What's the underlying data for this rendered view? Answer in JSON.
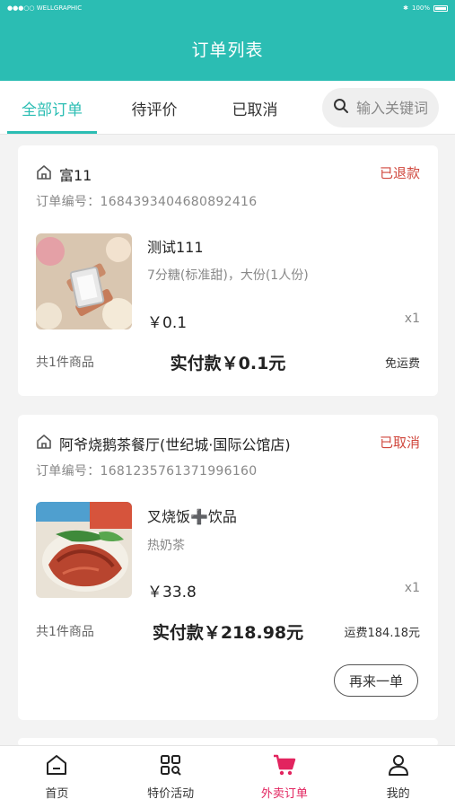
{
  "status_bar": {
    "carrier": "●●●○○ WELLGRAPHIC",
    "battery": "100%"
  },
  "header": {
    "title": "订单列表"
  },
  "tabs": [
    {
      "label": "全部订单"
    },
    {
      "label": "待评价"
    },
    {
      "label": "已取消"
    }
  ],
  "search": {
    "placeholder": "输入关键词"
  },
  "orders": [
    {
      "shop": "富11",
      "status": "已退款",
      "order_no": "订单编号：1684393404680892416",
      "item": {
        "name": "测试111",
        "spec": "7分糖(标准甜)，大份(1人份)",
        "price": "￥0.1",
        "qty": "x1"
      },
      "count": "共1件商品",
      "total": "实付款￥0.1元",
      "shipping": "免运费"
    },
    {
      "shop": "阿爷烧鹅茶餐厅(世纪城·国际公馆店)",
      "status": "已取消",
      "order_no": "订单编号：1681235761371996160",
      "item": {
        "name": "叉烧饭➕饮品",
        "spec": "热奶茶",
        "price": "￥33.8",
        "qty": "x1"
      },
      "count": "共1件商品",
      "total": "实付款￥218.98元",
      "shipping": "运费184.18元",
      "action": "再来一单"
    }
  ],
  "nav": [
    {
      "label": "首页",
      "icon": "home-icon"
    },
    {
      "label": "特价活动",
      "icon": "grid-search-icon"
    },
    {
      "label": "外卖订单",
      "icon": "cart-icon"
    },
    {
      "label": "我的",
      "icon": "user-icon"
    }
  ],
  "colors": {
    "primary": "#2bbdb3",
    "status": "#d0473d",
    "nav_active": "#e2245f"
  }
}
